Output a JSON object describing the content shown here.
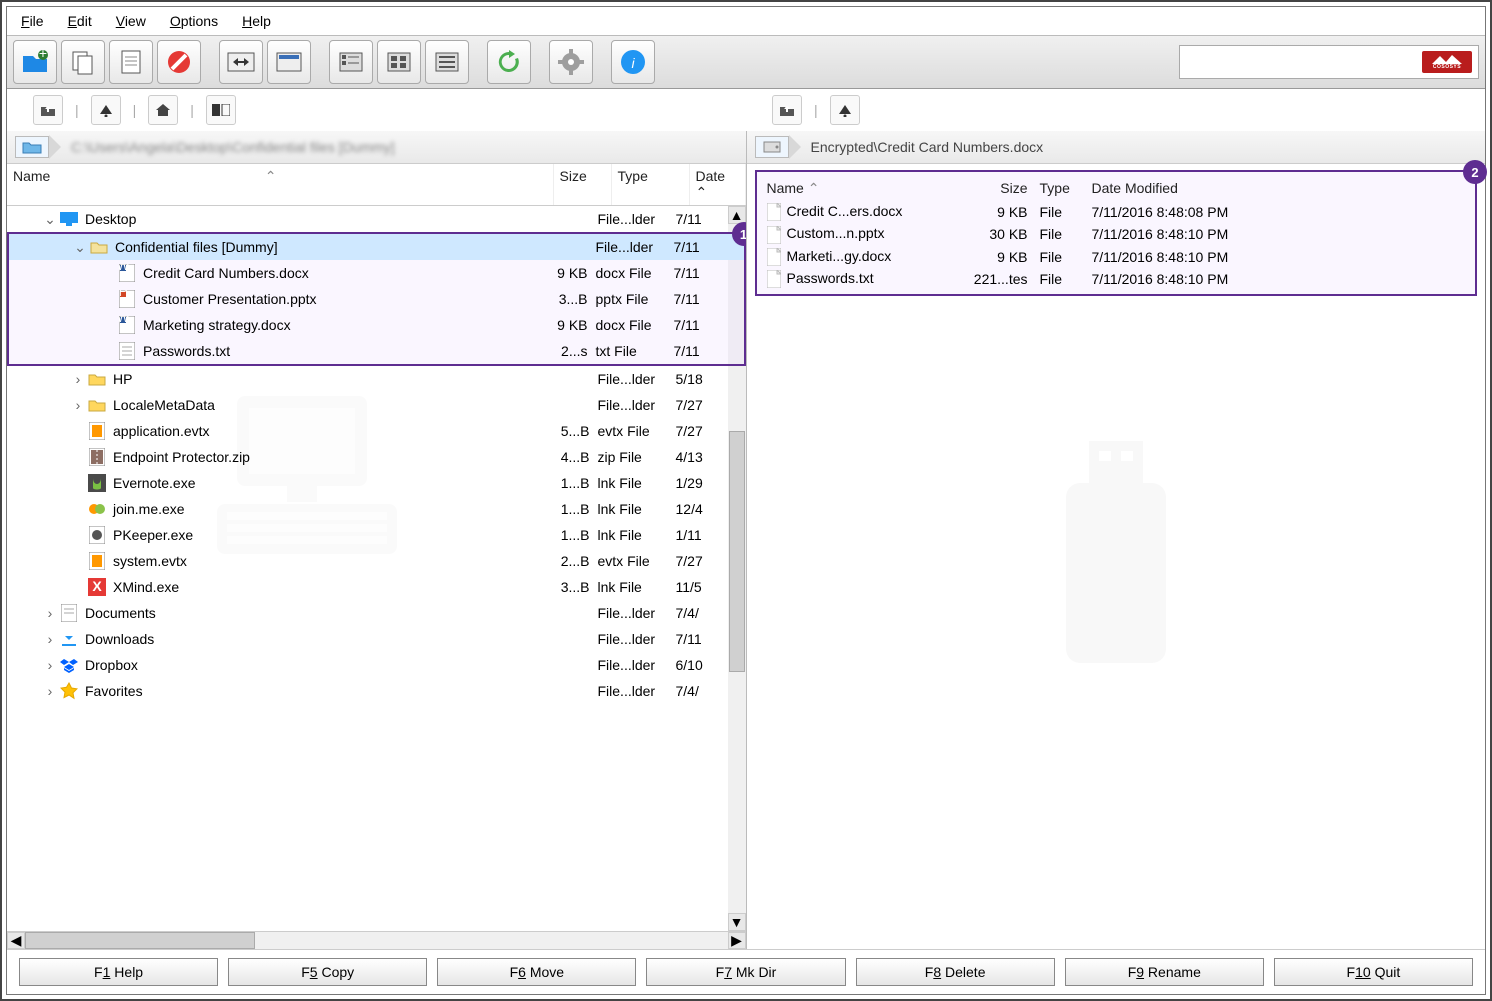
{
  "menu": {
    "file": "File",
    "edit": "Edit",
    "view": "View",
    "options": "Options",
    "help": "Help"
  },
  "left": {
    "path_blur": "C:\\Users\\Angela\\Desktop\\Confidential files [Dummy]",
    "cols": {
      "name": "Name",
      "size": "Size",
      "type": "Type",
      "date": "Date"
    },
    "rows": [
      {
        "indent": 1,
        "chev": "v",
        "icon": "monitor",
        "label": "Desktop",
        "size": "",
        "type": "File...lder",
        "date": "7/11",
        "sel": false
      },
      {
        "indent": 2,
        "chev": "v",
        "icon": "folder",
        "label": "Confidential files [Dummy]",
        "size": "",
        "type": "File...lder",
        "date": "7/11",
        "sel": true,
        "hl": true
      },
      {
        "indent": 3,
        "chev": "",
        "icon": "docx",
        "label": "Credit Card Numbers.docx",
        "size": "9 KB",
        "type": "docx File",
        "date": "7/11",
        "hl": true
      },
      {
        "indent": 3,
        "chev": "",
        "icon": "pptx",
        "label": "Customer Presentation.pptx",
        "size": "3...B",
        "type": "pptx File",
        "date": "7/11",
        "hl": true
      },
      {
        "indent": 3,
        "chev": "",
        "icon": "docx",
        "label": "Marketing strategy.docx",
        "size": "9 KB",
        "type": "docx File",
        "date": "7/11",
        "hl": true
      },
      {
        "indent": 3,
        "chev": "",
        "icon": "txt",
        "label": "Passwords.txt",
        "size": "2...s",
        "type": "txt File",
        "date": "7/11",
        "hl": true
      },
      {
        "indent": 2,
        "chev": ">",
        "icon": "folder-y",
        "label": "HP",
        "size": "",
        "type": "File...lder",
        "date": "5/18"
      },
      {
        "indent": 2,
        "chev": ">",
        "icon": "folder-y",
        "label": "LocaleMetaData",
        "size": "",
        "type": "File...lder",
        "date": "7/27"
      },
      {
        "indent": 2,
        "chev": "",
        "icon": "evtx",
        "label": "application.evtx",
        "size": "5...B",
        "type": "evtx File",
        "date": "7/27"
      },
      {
        "indent": 2,
        "chev": "",
        "icon": "zip",
        "label": "Endpoint Protector.zip",
        "size": "4...B",
        "type": "zip File",
        "date": "4/13"
      },
      {
        "indent": 2,
        "chev": "",
        "icon": "evernote",
        "label": "Evernote.exe",
        "size": "1...B",
        "type": "lnk File",
        "date": "1/29"
      },
      {
        "indent": 2,
        "chev": "",
        "icon": "joinme",
        "label": "join.me.exe",
        "size": "1...B",
        "type": "lnk File",
        "date": "12/4"
      },
      {
        "indent": 2,
        "chev": "",
        "icon": "exe",
        "label": "PKeeper.exe",
        "size": "1...B",
        "type": "lnk File",
        "date": "1/11"
      },
      {
        "indent": 2,
        "chev": "",
        "icon": "evtx",
        "label": "system.evtx",
        "size": "2...B",
        "type": "evtx File",
        "date": "7/27"
      },
      {
        "indent": 2,
        "chev": "",
        "icon": "xmind",
        "label": "XMind.exe",
        "size": "3...B",
        "type": "lnk File",
        "date": "11/5"
      },
      {
        "indent": 1,
        "chev": ">",
        "icon": "doc",
        "label": "Documents",
        "size": "",
        "type": "File...lder",
        "date": "7/4/"
      },
      {
        "indent": 1,
        "chev": ">",
        "icon": "download",
        "label": "Downloads",
        "size": "",
        "type": "File...lder",
        "date": "7/11"
      },
      {
        "indent": 1,
        "chev": ">",
        "icon": "dropbox",
        "label": "Dropbox",
        "size": "",
        "type": "File...lder",
        "date": "6/10"
      },
      {
        "indent": 1,
        "chev": ">",
        "icon": "star",
        "label": "Favorites",
        "size": "",
        "type": "File...lder",
        "date": "7/4/"
      }
    ]
  },
  "right": {
    "path": "Encrypted\\Credit Card Numbers.docx",
    "cols": {
      "name": "Name",
      "size": "Size",
      "type": "Type",
      "date": "Date Modified"
    },
    "rows": [
      {
        "name": "Credit C...ers.docx",
        "size": "9 KB",
        "type": "File",
        "date": "7/11/2016 8:48:08 PM"
      },
      {
        "name": "Custom...n.pptx",
        "size": "30 KB",
        "type": "File",
        "date": "7/11/2016 8:48:10 PM"
      },
      {
        "name": "Marketi...gy.docx",
        "size": "9 KB",
        "type": "File",
        "date": "7/11/2016 8:48:10 PM"
      },
      {
        "name": "Passwords.txt",
        "size": "221...tes",
        "type": "File",
        "date": "7/11/2016 8:48:10 PM"
      }
    ]
  },
  "badges": {
    "one": "1",
    "two": "2"
  },
  "footer": [
    {
      "key": "F1",
      "label": "Help"
    },
    {
      "key": "F5",
      "label": "Copy"
    },
    {
      "key": "F6",
      "label": "Move"
    },
    {
      "key": "F7",
      "label": "Mk Dir"
    },
    {
      "key": "F8",
      "label": "Delete"
    },
    {
      "key": "F9",
      "label": "Rename"
    },
    {
      "key": "F10",
      "label": "Quit"
    }
  ],
  "brand": "COSOSYS"
}
